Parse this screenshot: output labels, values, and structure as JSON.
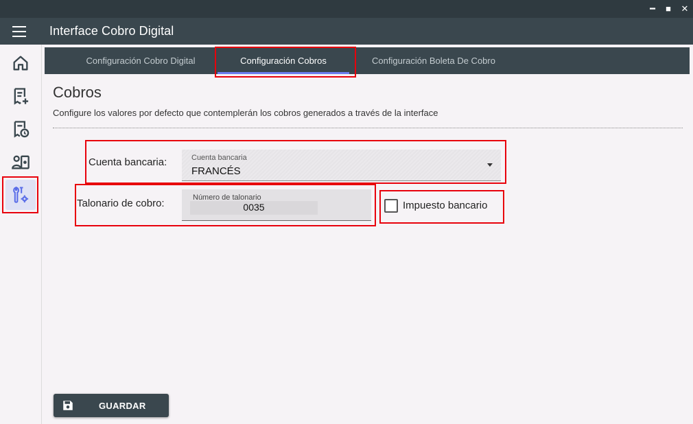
{
  "window": {
    "minimize": "━",
    "maximize": "■",
    "close": "✕"
  },
  "header": {
    "title": "Interface Cobro Digital"
  },
  "sidebar": {
    "items": [
      {
        "icon": "home-icon"
      },
      {
        "icon": "receipt-add-icon"
      },
      {
        "icon": "receipt-clock-icon"
      },
      {
        "icon": "user-money-icon"
      },
      {
        "icon": "tools-gear-icon",
        "active": true
      }
    ]
  },
  "tabs": [
    {
      "label": "Configuración Cobro Digital"
    },
    {
      "label": "Configuración Cobros",
      "active": true
    },
    {
      "label": "Configuración Boleta De Cobro"
    }
  ],
  "section": {
    "title": "Cobros",
    "description": "Configure los valores por defecto que contemplerán los cobros generados a través de la interface"
  },
  "form": {
    "cuenta_label": "Cuenta bancaria:",
    "cuenta_field_label": "Cuenta bancaria",
    "cuenta_value": "FRANCÉS",
    "talonario_label": "Talonario de cobro:",
    "talonario_field_label": "Número de talonario",
    "talonario_value": "0035",
    "impuesto_label": "Impuesto bancario",
    "impuesto_checked": false
  },
  "actions": {
    "save_label": "GUARDAR"
  },
  "colors": {
    "header": "#3a474e",
    "accent": "#6d7df0",
    "highlight": "#e8000b"
  }
}
